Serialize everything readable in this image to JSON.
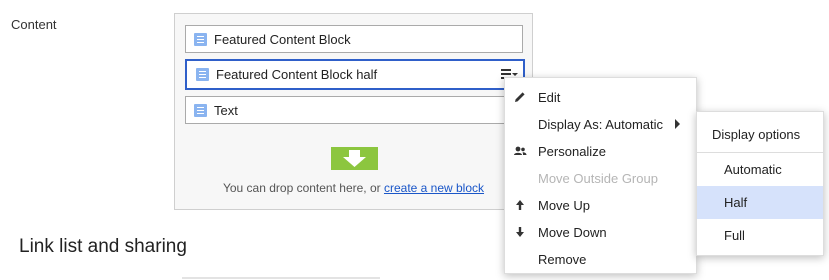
{
  "field": {
    "label": "Content"
  },
  "content_area": {
    "blocks": [
      {
        "label": "Featured Content Block"
      },
      {
        "label": "Featured Content Block half"
      },
      {
        "label": "Text"
      }
    ],
    "drop_hint": {
      "text": "You can drop content here, or ",
      "link": "create a new block"
    }
  },
  "section": {
    "heading": "Link list and sharing"
  },
  "context_menu": {
    "items": [
      {
        "label": "Edit",
        "icon": "pencil-icon",
        "disabled": false
      },
      {
        "label": "Display As: Automatic",
        "icon": "",
        "disabled": false,
        "has_submenu": true
      },
      {
        "label": "Personalize",
        "icon": "people-icon",
        "disabled": false
      },
      {
        "label": "Move Outside Group",
        "icon": "",
        "disabled": true
      },
      {
        "label": "Move Up",
        "icon": "arrow-up-icon",
        "disabled": false
      },
      {
        "label": "Move Down",
        "icon": "arrow-down-icon",
        "disabled": false
      },
      {
        "label": "Remove",
        "icon": "",
        "disabled": false
      }
    ]
  },
  "display_submenu": {
    "title": "Display options",
    "options": [
      {
        "label": "Automatic",
        "selected": false
      },
      {
        "label": "Half",
        "selected": true
      },
      {
        "label": "Full",
        "selected": false
      }
    ]
  },
  "colors": {
    "accent": "#2f5fc9",
    "drop_icon": "#8cc63f",
    "selected_option": "#d6e2fb",
    "link": "#1a56c8"
  }
}
